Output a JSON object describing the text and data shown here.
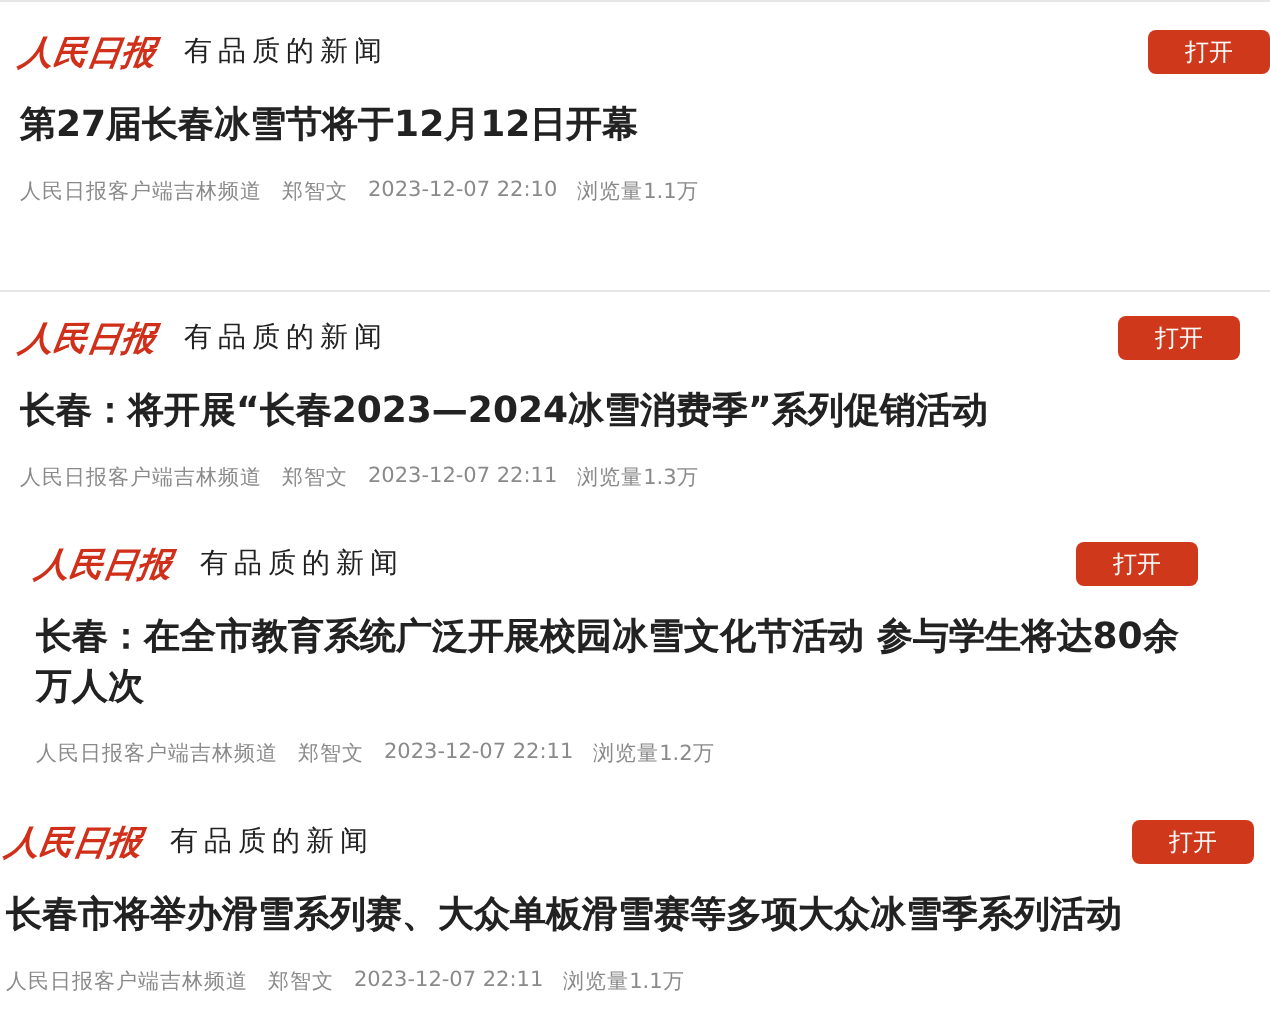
{
  "articles": [
    {
      "logo": "人民日报",
      "tagline": "有品质的新闻",
      "button": "打开",
      "title": "第27届长春冰雪节将于12月12日开幕",
      "source": "人民日报客户端吉林频道",
      "author": "郑智文",
      "time": "2023-12-07 22:10",
      "views": "浏览量1.1万"
    },
    {
      "logo": "人民日报",
      "tagline": "有品质的新闻",
      "button": "打开",
      "title": "长春：将开展“长春2023—2024冰雪消费季”系列促销活动",
      "source": "人民日报客户端吉林频道",
      "author": "郑智文",
      "time": "2023-12-07 22:11",
      "views": "浏览量1.3万"
    },
    {
      "logo": "人民日报",
      "tagline": "有品质的新闻",
      "button": "打开",
      "title": "长春：在全市教育系统广泛开展校园冰雪文化节活动 参与学生将达80余万人次",
      "source": "人民日报客户端吉林频道",
      "author": "郑智文",
      "time": "2023-12-07 22:11",
      "views": "浏览量1.2万"
    },
    {
      "logo": "人民日报",
      "tagline": "有品质的新闻",
      "button": "打开",
      "title": "长春市将举办滑雪系列赛、大众单板滑雪赛等多项大众冰雪季系列活动",
      "source": "人民日报客户端吉林频道",
      "author": "郑智文",
      "time": "2023-12-07 22:11",
      "views": "浏览量1.1万"
    }
  ]
}
